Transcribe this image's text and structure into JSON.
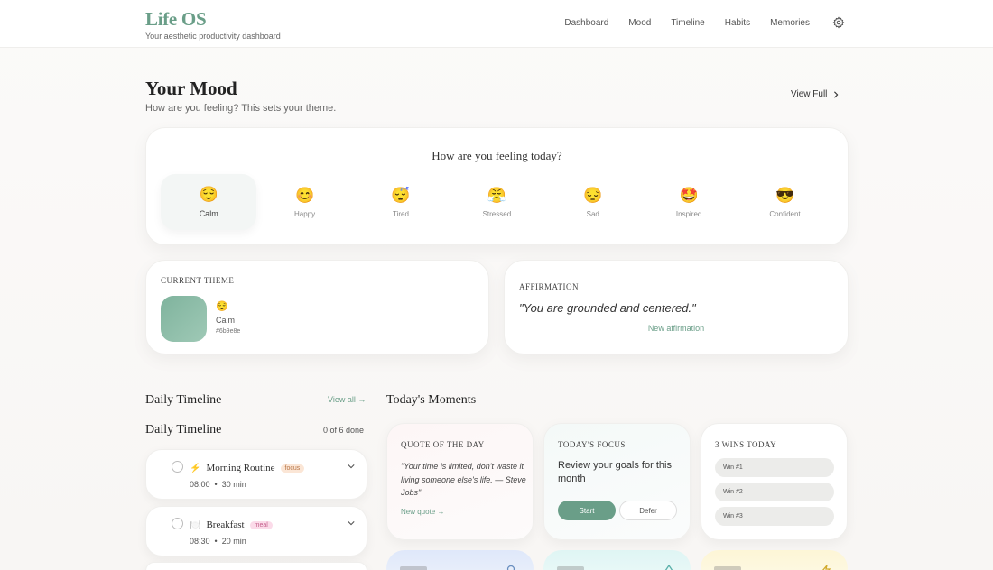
{
  "app": {
    "title": "Life OS",
    "subtitle": "Your aesthetic productivity dashboard",
    "accent": "#6a9e88"
  },
  "nav": {
    "items": [
      "Dashboard",
      "Mood",
      "Timeline",
      "Habits",
      "Memories"
    ],
    "settings_icon": "gear-icon"
  },
  "mood_section": {
    "title": "Your Mood",
    "subtitle": "How are you feeling? This sets your theme.",
    "view_full": "View Full",
    "question": "How are you feeling today?",
    "options": [
      {
        "emoji": "😌",
        "label": "Calm",
        "selected": true
      },
      {
        "emoji": "😊",
        "label": "Happy",
        "selected": false
      },
      {
        "emoji": "😴",
        "label": "Tired",
        "selected": false
      },
      {
        "emoji": "😤",
        "label": "Stressed",
        "selected": false
      },
      {
        "emoji": "😔",
        "label": "Sad",
        "selected": false
      },
      {
        "emoji": "🤩",
        "label": "Inspired",
        "selected": false
      },
      {
        "emoji": "😎",
        "label": "Confident",
        "selected": false
      }
    ]
  },
  "theme": {
    "caption": "CURRENT THEME",
    "emoji": "😌",
    "name": "Calm",
    "hex": "#6b9e8e"
  },
  "affirmation": {
    "caption": "AFFIRMATION",
    "text": "\"You are grounded and centered.\"",
    "link": "New affirmation"
  },
  "timeline": {
    "title": "Daily Timeline",
    "view_all": "View all →",
    "subtitle": "Daily Timeline",
    "count": "0 of 6 done",
    "items": [
      {
        "icon": "⚡",
        "name": "Morning Routine",
        "tag": "focus",
        "time": "08:00",
        "duration": "30 min"
      },
      {
        "icon": "🍽️",
        "name": "Breakfast",
        "tag": "meal",
        "time": "08:30",
        "duration": "20 min"
      }
    ]
  },
  "moments": {
    "title": "Today's Moments",
    "quote": {
      "caption": "QUOTE OF THE DAY",
      "text": "\"Your time is limited, don't waste it living someone else's life. — Steve Jobs\"",
      "link": "New quote →"
    },
    "focus": {
      "caption": "TODAY'S FOCUS",
      "text": "Review your goals for this month",
      "start": "Start",
      "defer": "Defer"
    },
    "wins": {
      "caption": "3 WINS TODAY",
      "placeholders": [
        "Win #1",
        "Win #2",
        "Win #3"
      ]
    }
  }
}
